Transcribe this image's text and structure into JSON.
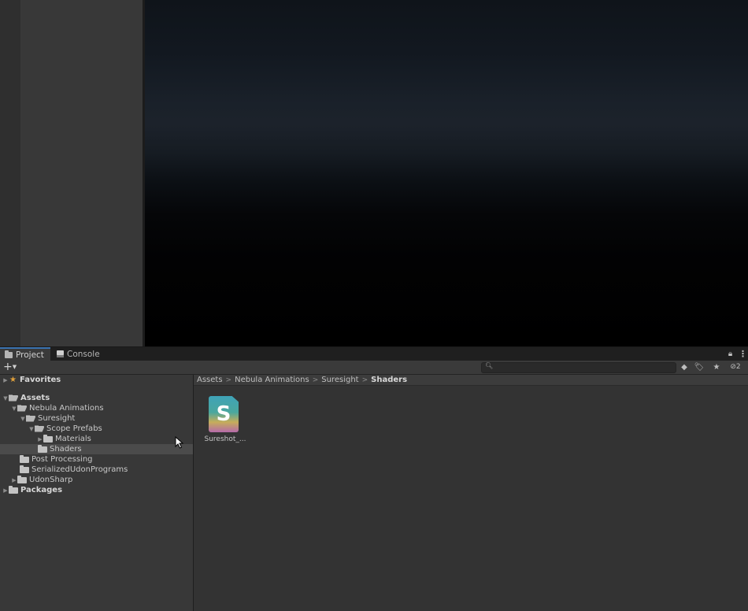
{
  "tabs": {
    "project": "Project",
    "console": "Console"
  },
  "toolbar": {
    "create_label": "+",
    "hidden_count": "2"
  },
  "tree": {
    "favorites": "Favorites",
    "assets": "Assets",
    "nebula_animations": "Nebula Animations",
    "suresight": "Suresight",
    "scope_prefabs": "Scope Prefabs",
    "materials": "Materials",
    "shaders": "Shaders",
    "post_processing": "Post Processing",
    "serialized_udon": "SerializedUdonPrograms",
    "udonsharp": "UdonSharp",
    "packages": "Packages"
  },
  "breadcrumb": [
    "Assets",
    "Nebula Animations",
    "Suresight",
    "Shaders"
  ],
  "assets": [
    {
      "name": "Sureshot_...",
      "glyph": "S"
    }
  ],
  "icons": {
    "folder": "folder-icon",
    "star": "star-icon",
    "shader": "shader-file-icon",
    "lock": "lock-icon",
    "search": "search-icon"
  },
  "colors": {
    "accent": "#3a72b0",
    "favorites_star": "#e1a13b"
  }
}
